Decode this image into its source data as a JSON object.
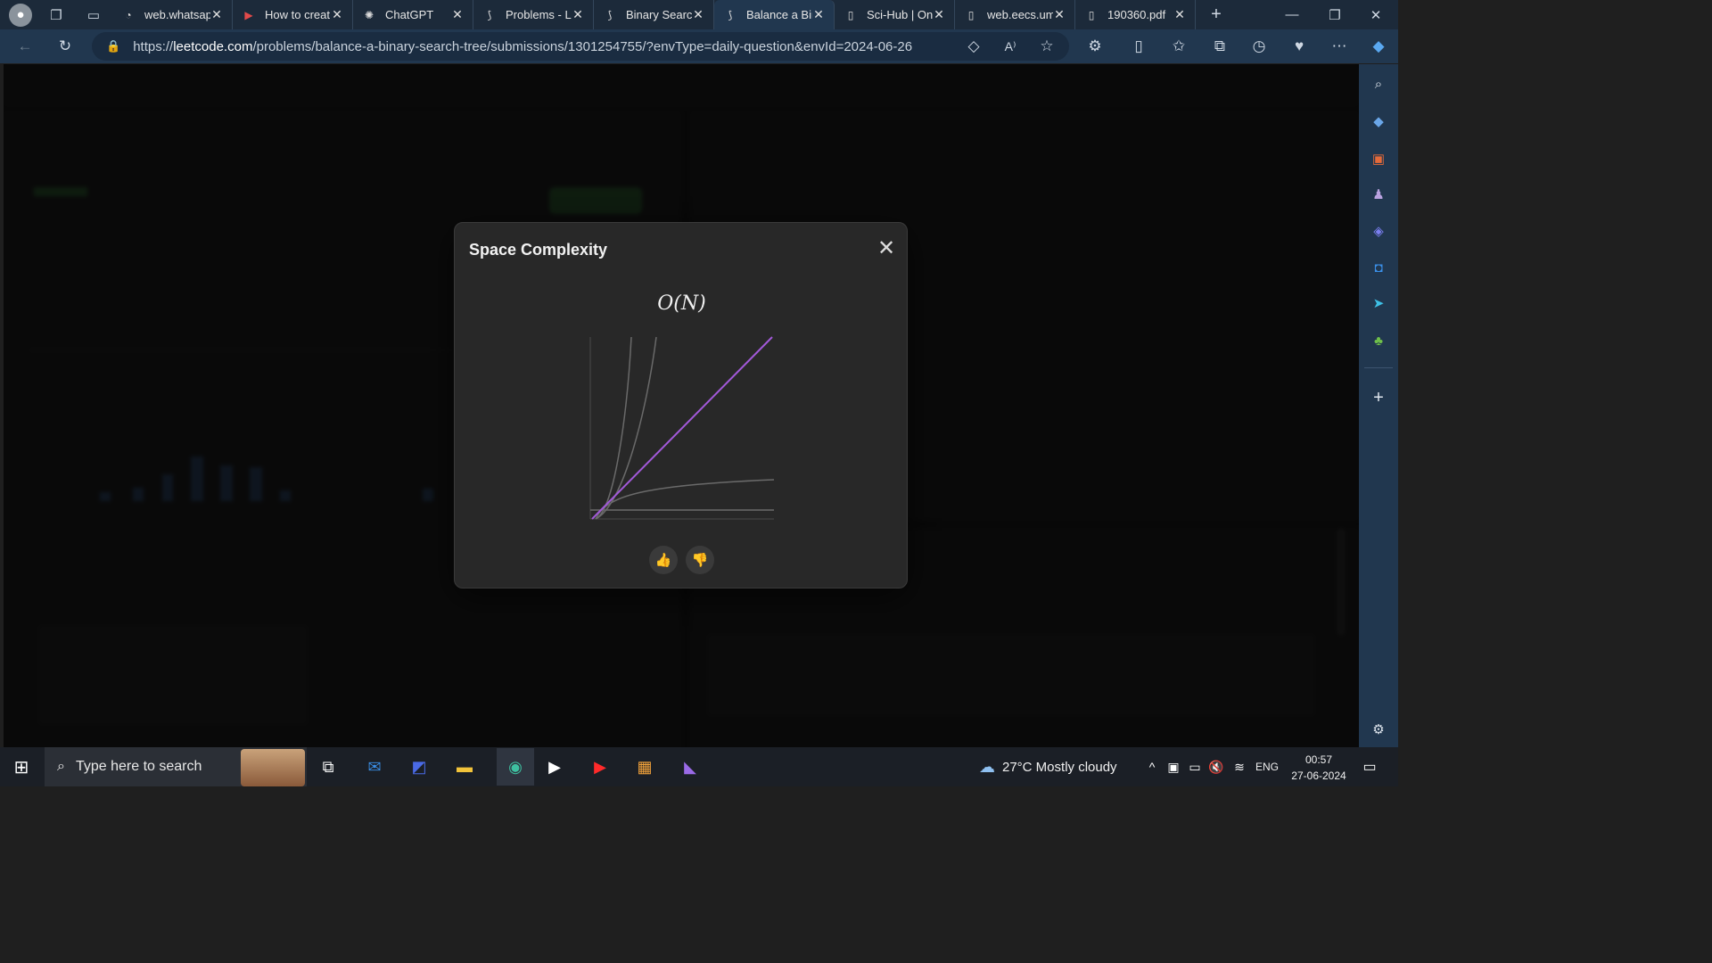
{
  "browser": {
    "tabs": [
      {
        "title": "web.whatsapp",
        "favicon": "whatsapp-icon"
      },
      {
        "title": "How to creat",
        "favicon": "youtube-icon"
      },
      {
        "title": "ChatGPT",
        "favicon": "openai-icon"
      },
      {
        "title": "Problems - L",
        "favicon": "leetcode-icon"
      },
      {
        "title": "Binary Search",
        "favicon": "leetcode-icon"
      },
      {
        "title": "Balance a Bin",
        "favicon": "leetcode-icon",
        "active": true
      },
      {
        "title": "Sci-Hub | On",
        "favicon": "page-icon"
      },
      {
        "title": "web.eecs.um",
        "favicon": "page-icon"
      },
      {
        "title": "190360.pdf",
        "favicon": "pdf-icon"
      }
    ],
    "address": {
      "prefix": "https://",
      "host": "leetcode.com",
      "path": "/problems/balance-a-binary-search-tree/submissions/1301254755/?envType=daily-question&envId=2024-06-26"
    }
  },
  "modal": {
    "title": "Space Complexity",
    "complexity": "O(N)",
    "close_label": "✕",
    "like_label": "👍",
    "dislike_label": "👎",
    "highlight_color": "#a259d9"
  },
  "taskbar": {
    "search_placeholder": "Type here to search",
    "weather": "27°C  Mostly cloudy",
    "language": "ENG",
    "time": "00:57",
    "date": "27-06-2024"
  }
}
